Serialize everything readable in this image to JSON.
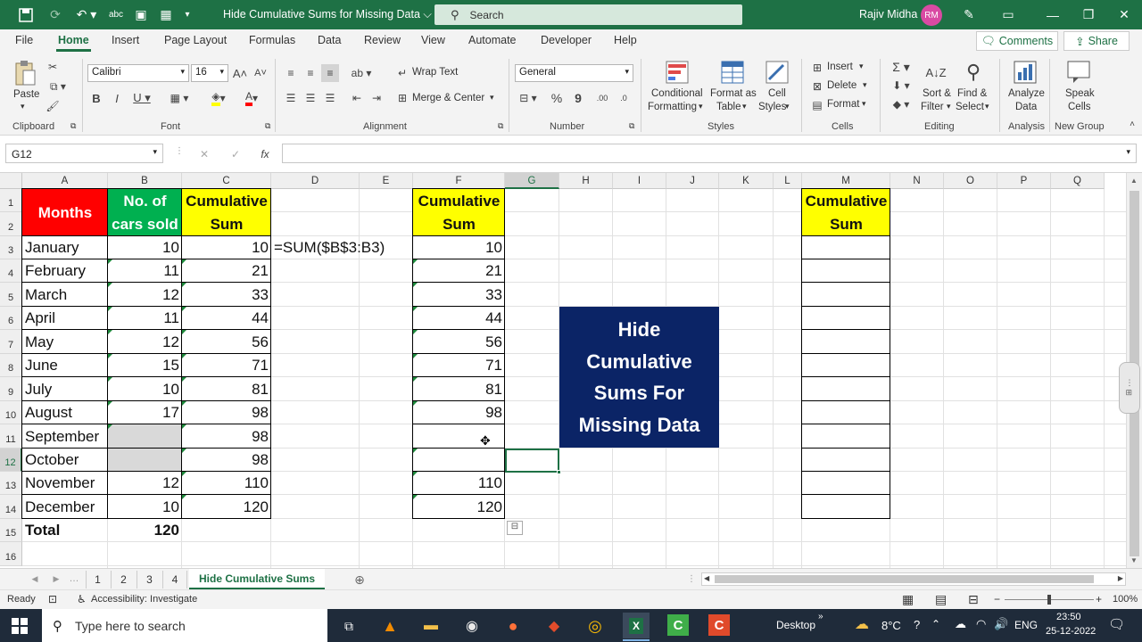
{
  "app": {
    "doc_title": "Hide Cumulative Sums for Missing Data",
    "search_placeholder": "Search",
    "user_name": "Rajiv Midha",
    "user_initials": "RM"
  },
  "ribbon_tabs": [
    "File",
    "Home",
    "Insert",
    "Page Layout",
    "Formulas",
    "Data",
    "Review",
    "View",
    "Automate",
    "Developer",
    "Help"
  ],
  "ribbon_actions": {
    "comments": "Comments",
    "share": "Share"
  },
  "ribbon": {
    "paste": "Paste",
    "font_name": "Calibri",
    "font_size": "16",
    "wrap_text": "Wrap Text",
    "merge_center": "Merge & Center",
    "number_format": "General",
    "conditional_formatting": [
      "Conditional",
      "Formatting"
    ],
    "format_as_table": [
      "Format as",
      "Table"
    ],
    "cell_styles": [
      "Cell",
      "Styles"
    ],
    "insert": "Insert",
    "delete": "Delete",
    "format": "Format",
    "sort_filter": [
      "Sort &",
      "Filter"
    ],
    "find_select": [
      "Find &",
      "Select"
    ],
    "analyze_data": [
      "Analyze",
      "Data"
    ],
    "speak_cells": [
      "Speak",
      "Cells"
    ],
    "groups": [
      "Clipboard",
      "Font",
      "Alignment",
      "Number",
      "Styles",
      "Cells",
      "Editing",
      "Analysis",
      "New Group"
    ]
  },
  "formula_bar": {
    "name_box": "G12",
    "formula": ""
  },
  "columns": [
    "A",
    "B",
    "C",
    "D",
    "E",
    "F",
    "G",
    "H",
    "I",
    "J",
    "K",
    "L",
    "M",
    "N",
    "O",
    "P",
    "Q"
  ],
  "rows": [
    "1",
    "2",
    "3",
    "4",
    "5",
    "6",
    "7",
    "8",
    "9",
    "10",
    "11",
    "12",
    "13",
    "14",
    "15",
    "16"
  ],
  "table1": {
    "header_months": "Months",
    "header_cars_1": "No. of",
    "header_cars_2": "cars sold",
    "header_cum_1": "Cumulative",
    "header_cum_2": "Sum",
    "months": [
      "January",
      "February",
      "March",
      "April",
      "May",
      "June",
      "July",
      "August",
      "September",
      "October",
      "November",
      "December"
    ],
    "cars": [
      "10",
      "11",
      "12",
      "11",
      "12",
      "15",
      "10",
      "17",
      "",
      "",
      "12",
      "10"
    ],
    "cumulative": [
      "10",
      "21",
      "33",
      "44",
      "56",
      "71",
      "81",
      "98",
      "98",
      "98",
      "110",
      "120"
    ],
    "total_label": "Total",
    "total_value": "120"
  },
  "formula_note": "=SUM($B$3:B3)",
  "table2": {
    "header_1": "Cumulative",
    "header_2": "Sum",
    "values": [
      "10",
      "21",
      "33",
      "44",
      "56",
      "71",
      "81",
      "98",
      "",
      "",
      "110",
      "120"
    ]
  },
  "table3": {
    "header_1": "Cumulative",
    "header_2": "Sum",
    "values": [
      "",
      "",
      "",
      "",
      "",
      "",
      "",
      "",
      "",
      "",
      "",
      ""
    ]
  },
  "banner": {
    "lines": [
      "Hide",
      "Cumulative",
      "Sums For",
      "Missing Data"
    ]
  },
  "sheet_tabs": [
    "1",
    "2",
    "3",
    "4",
    "Hide Cumulative Sums"
  ],
  "active_sheet": "Hide Cumulative Sums",
  "status": {
    "ready": "Ready",
    "accessibility": "Accessibility: Investigate",
    "zoom": "100%"
  },
  "taskbar": {
    "search_placeholder": "Type here to search",
    "desktop": "Desktop",
    "temperature": "8°C",
    "language": "ENG",
    "time": "23:50",
    "date": "25-12-2022"
  },
  "colors": {
    "excel_green": "#1e7145",
    "header_red": "#ff0000",
    "header_green": "#00b050",
    "header_yellow": "#ffff00",
    "banner_navy": "#0b2466",
    "missing_gray": "#d9d9d9"
  }
}
